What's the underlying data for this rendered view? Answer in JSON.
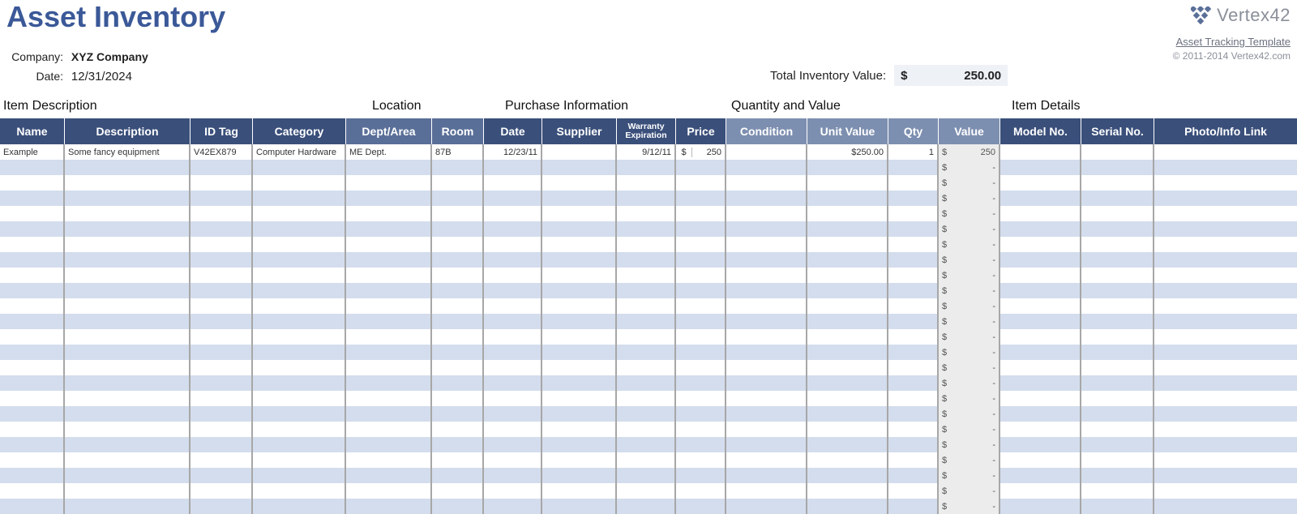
{
  "header": {
    "title": "Asset Inventory",
    "brand_text": "Vertex42",
    "brand_link": "Asset Tracking Template",
    "brand_copy": "© 2011-2014 Vertex42.com",
    "company_label": "Company:",
    "company_value": "XYZ Company",
    "date_label": "Date:",
    "date_value": "12/31/2024",
    "total_label": "Total Inventory Value:",
    "total_currency": "$",
    "total_amount": "250.00"
  },
  "groups": {
    "item_description": "Item Description",
    "location": "Location",
    "purchase_info": "Purchase Information",
    "qty_value": "Quantity and Value",
    "item_details": "Item Details"
  },
  "columns": {
    "name": "Name",
    "description": "Description",
    "id_tag": "ID Tag",
    "category": "Category",
    "dept_area": "Dept/Area",
    "room": "Room",
    "date": "Date",
    "supplier": "Supplier",
    "warranty": "Warranty Expiration",
    "price": "Price",
    "condition": "Condition",
    "unit_value": "Unit Value",
    "qty": "Qty",
    "value": "Value",
    "model_no": "Model No.",
    "serial_no": "Serial No.",
    "photo_link": "Photo/Info Link"
  },
  "rows": [
    {
      "name": "Example",
      "description": "Some fancy equipment",
      "id_tag": "V42EX879",
      "category": "Computer Hardware",
      "dept_area": "ME Dept.",
      "room": "87B",
      "date": "12/23/11",
      "supplier": "",
      "warranty": "9/12/11",
      "price_sym": "$",
      "price_val": "250",
      "condition": "",
      "unit_value": "$250.00",
      "qty": "1",
      "value_sym": "$",
      "value_val": "250",
      "model_no": "",
      "serial_no": "",
      "photo_link": ""
    }
  ],
  "empty_row": {
    "value_sym": "$",
    "value_val": "-"
  },
  "empty_row_count": 23
}
